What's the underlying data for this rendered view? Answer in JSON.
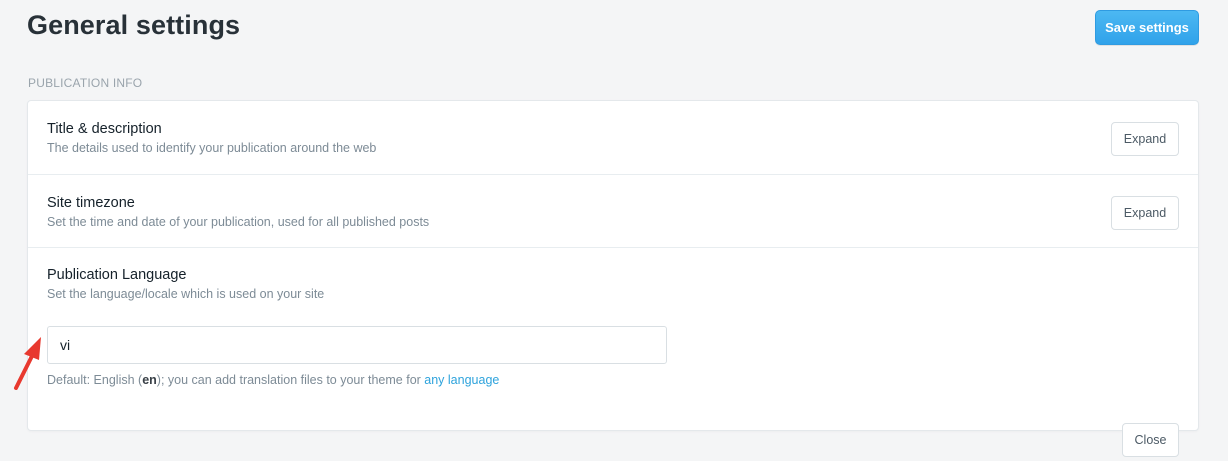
{
  "header": {
    "title": "General settings",
    "save_label": "Save settings"
  },
  "section": {
    "heading": "PUBLICATION INFO"
  },
  "rows": [
    {
      "title": "Title & description",
      "description": "The details used to identify your publication around the web",
      "button_label": "Expand"
    },
    {
      "title": "Site timezone",
      "description": "Set the time and date of your publication, used for all published posts",
      "button_label": "Expand"
    },
    {
      "title": "Publication Language",
      "description": "Set the language/locale which is used on your site",
      "button_label": "Close",
      "input_value": "vi",
      "hint_prefix": "Default: English (",
      "hint_code": "en",
      "hint_middle": "); you can add translation files to your theme for ",
      "hint_link": "any language"
    }
  ],
  "icons": {
    "pointer_arrow": "arrow-icon"
  },
  "colors": {
    "accent": "#30a2ea",
    "link": "#2ea3dc",
    "arrow": "#e8392f"
  }
}
